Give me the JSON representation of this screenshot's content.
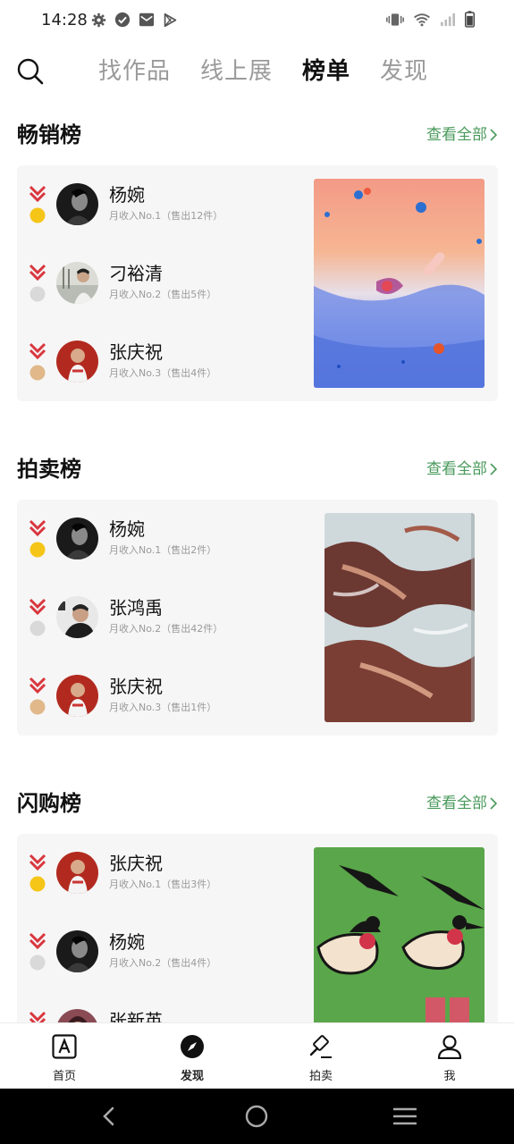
{
  "status_bar": {
    "time": "14:28",
    "left_icons": [
      "gear-icon",
      "check-circle-icon",
      "mail-icon",
      "play-store-icon"
    ],
    "right_icons": [
      "vibrate-icon",
      "wifi-icon",
      "signal-icon",
      "battery-icon"
    ]
  },
  "top_nav": {
    "search_icon": "search-icon",
    "tabs": [
      {
        "label": "找作品",
        "active": false
      },
      {
        "label": "线上展",
        "active": false
      },
      {
        "label": "榜单",
        "active": true
      },
      {
        "label": "发现",
        "active": false
      }
    ]
  },
  "sections": [
    {
      "title": "畅销榜",
      "view_all": "查看全部",
      "rows": [
        {
          "name": "杨婉",
          "sub": "月收入No.1（售出12件）",
          "medal": "gold"
        },
        {
          "name": "刁裕清",
          "sub": "月收入No.2（售出5件）",
          "medal": "silver"
        },
        {
          "name": "张庆祝",
          "sub": "月收入No.3（售出4件）",
          "medal": "bronze"
        }
      ]
    },
    {
      "title": "拍卖榜",
      "view_all": "查看全部",
      "rows": [
        {
          "name": "杨婉",
          "sub": "月收入No.1（售出2件）",
          "medal": "gold"
        },
        {
          "name": "张鸿禹",
          "sub": "月收入No.2（售出42件）",
          "medal": "silver"
        },
        {
          "name": "张庆祝",
          "sub": "月收入No.3（售出1件）",
          "medal": "bronze"
        }
      ]
    },
    {
      "title": "闪购榜",
      "view_all": "查看全部",
      "rows": [
        {
          "name": "张庆祝",
          "sub": "月收入No.1（售出3件）",
          "medal": "gold"
        },
        {
          "name": "杨婉",
          "sub": "月收入No.2（售出4件）",
          "medal": "silver"
        },
        {
          "name": "张新英",
          "sub": "",
          "medal": "bronze"
        }
      ]
    }
  ],
  "bottom_nav": [
    {
      "label": "首页",
      "icon": "home-a-icon",
      "active": false
    },
    {
      "label": "发现",
      "icon": "compass-icon",
      "active": true
    },
    {
      "label": "拍卖",
      "icon": "gavel-icon",
      "active": false
    },
    {
      "label": "我",
      "icon": "user-icon",
      "active": false
    }
  ],
  "colors": {
    "accent_green": "#4a9a5c",
    "medal_gold": "#f5c518",
    "medal_silver": "#d9d9d9",
    "medal_bronze": "#e0b88a",
    "ribbon_red": "#d9363e",
    "card_bg": "#f6f6f6"
  }
}
